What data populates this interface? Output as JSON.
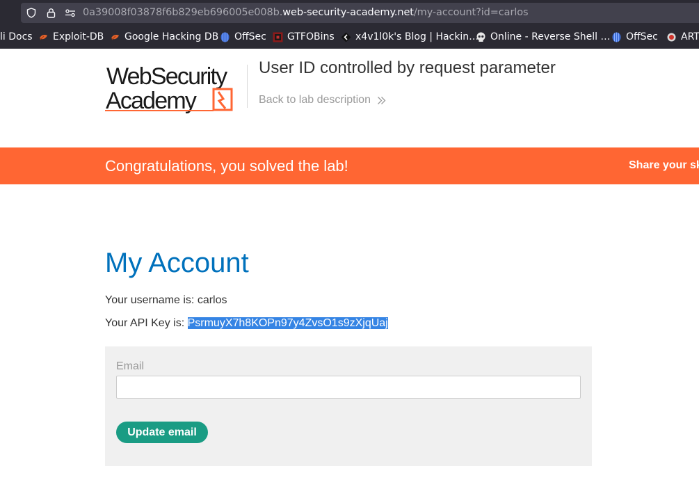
{
  "browser": {
    "url_prefix": "0a39008f03878f6b829eb696005e008b.",
    "url_host": "web-security-academy.net",
    "url_path": "/my-account?id=carlos",
    "bookmarks": [
      {
        "label": "li Docs",
        "icon": "kali-docs-icon"
      },
      {
        "label": "Exploit-DB",
        "icon": "exploit-db-icon"
      },
      {
        "label": "Google Hacking DB",
        "icon": "ghdb-icon"
      },
      {
        "label": "OffSec",
        "icon": "offsec-icon"
      },
      {
        "label": "GTFOBins",
        "icon": "gtfobins-icon"
      },
      {
        "label": "x4v1l0k's Blog | Hackin…",
        "icon": "blog-icon"
      },
      {
        "label": "Online - Reverse Shell …",
        "icon": "skull-icon"
      },
      {
        "label": "OffSec",
        "icon": "offsec-icon"
      },
      {
        "label": "ART",
        "icon": "art-icon"
      }
    ]
  },
  "lab": {
    "logo_line1": "WebSecurity",
    "logo_line2": "Academy",
    "title": "User ID controlled by request parameter",
    "back_link": "Back to lab description",
    "accent_color": "#ff6633"
  },
  "banner": {
    "message": "Congratulations, you solved the lab!",
    "share": "Share your sk"
  },
  "account": {
    "heading": "My Account",
    "username_line": "Your username is: carlos",
    "api_key_label": "Your API Key is: ",
    "api_key_value": "PsrmuyX7h8KOPn97y4ZvsO1s9zXjqUaj",
    "email_label": "Email",
    "email_value": "",
    "update_button": "Update email"
  }
}
